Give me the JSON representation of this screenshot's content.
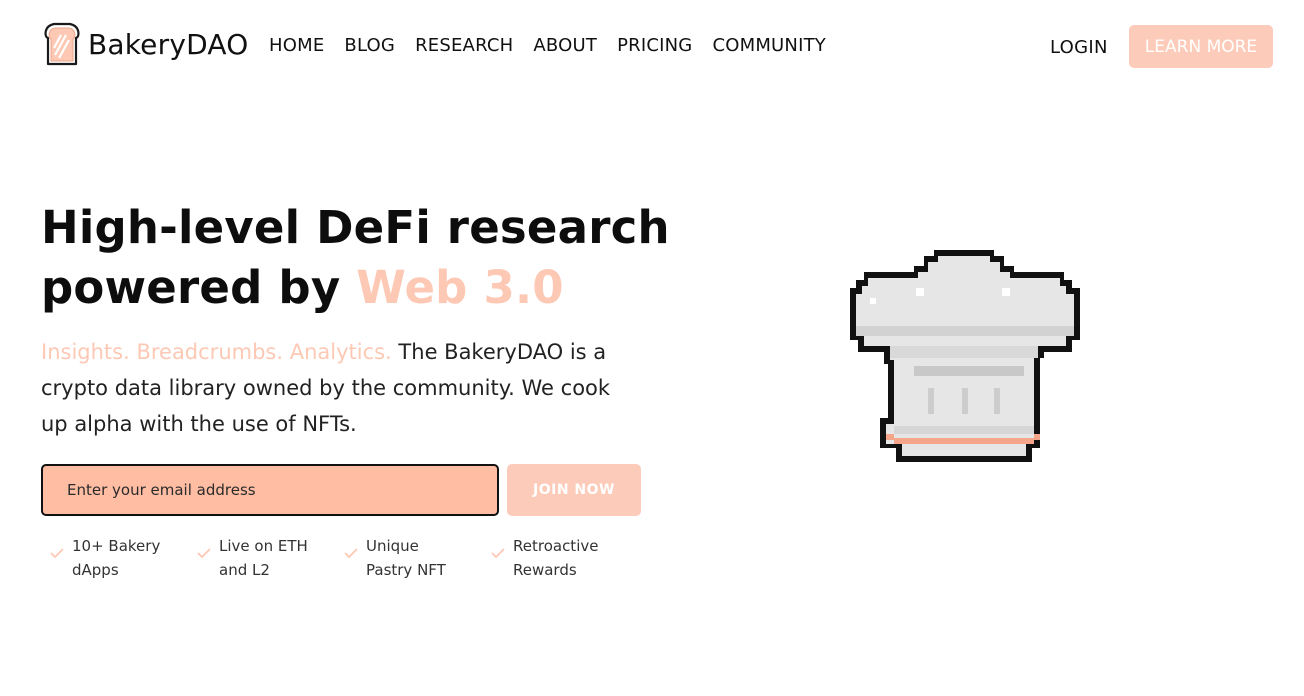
{
  "brand": {
    "name": "BakeryDAO",
    "logo_icon": "toast-icon"
  },
  "nav": {
    "items": [
      {
        "label": "HOME"
      },
      {
        "label": "BLOG"
      },
      {
        "label": "RESEARCH"
      },
      {
        "label": "ABOUT"
      },
      {
        "label": "PRICING"
      },
      {
        "label": "COMMUNITY"
      }
    ],
    "login_label": "LOGIN",
    "cta_label": "LEARN MORE"
  },
  "hero": {
    "title_line1": "High-level DeFi research",
    "title_line2_prefix": "powered by ",
    "title_line2_accent": "Web 3.0",
    "tagline": "Insights. Breadcrumbs. Analytics.",
    "description": " The BakeryDAO is a crypto data library owned by the community. We cook up alpha with the use of NFTs.",
    "email_placeholder": "Enter your email address",
    "join_label": "JOIN NOW",
    "illustration_icon": "chef-hat-icon"
  },
  "features": [
    {
      "label": "10+ Bakery dApps"
    },
    {
      "label": "Live on ETH and L2"
    },
    {
      "label": "Unique Pastry NFT"
    },
    {
      "label": "Retroactive Rewards"
    }
  ],
  "colors": {
    "accent": "#fdc8b4",
    "input_bg": "#ffbda3",
    "button_bg": "#fdcbb9",
    "text": "#111111"
  }
}
